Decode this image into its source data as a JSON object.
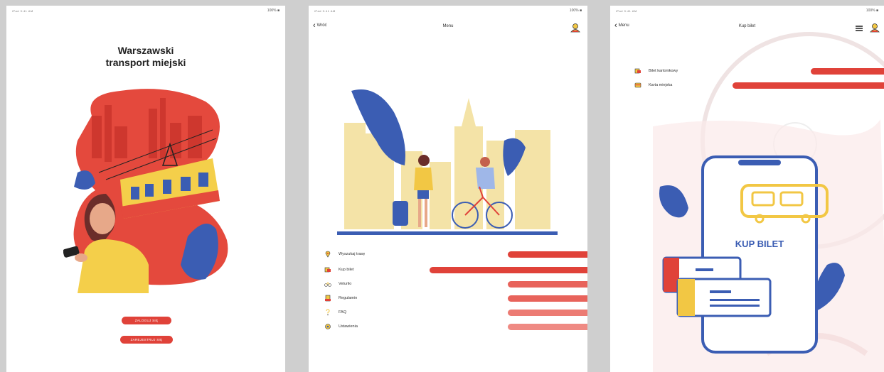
{
  "status_bar": {
    "left": "iPad  9:41 AM",
    "right": "100% ■"
  },
  "screen_login": {
    "title_line1": "Warszawski",
    "title_line2": "transport miejski",
    "login_button": "ZALOGUJ SIĘ",
    "register_button": "ZAREJESTRUJ SIĘ"
  },
  "screen_menu": {
    "back_label": "Wróć",
    "title": "Menu",
    "items": [
      {
        "label": "Wyszukaj trasę",
        "icon": "route-icon"
      },
      {
        "label": "Kup bilet",
        "icon": "ticket-icon"
      },
      {
        "label": "Veturilo",
        "icon": "bike-icon"
      },
      {
        "label": "Regulamin",
        "icon": "document-icon"
      },
      {
        "label": "FAQ",
        "icon": "question-icon"
      },
      {
        "label": "Ustawienia",
        "icon": "settings-icon"
      }
    ]
  },
  "screen_ticket": {
    "back_label": "Menu",
    "title": "Kup bilet",
    "items": [
      {
        "label": "Bilet kartonikowy",
        "icon": "paper-ticket-icon"
      },
      {
        "label": "Karta miejska",
        "icon": "city-card-icon"
      }
    ],
    "illustration_label": "KUP BILET"
  },
  "colors": {
    "accent": "#e04239",
    "accent_light": "#ef8a83",
    "blue": "#3b5db3",
    "yellow": "#f2c744",
    "sand": "#f4e3a7"
  }
}
